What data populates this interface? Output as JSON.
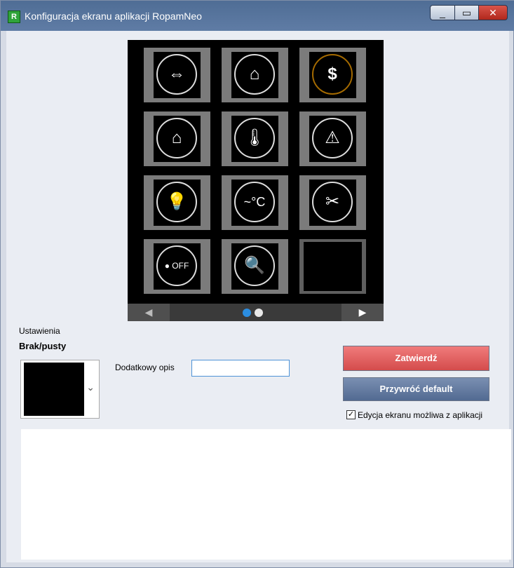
{
  "window": {
    "title": "Konfiguracja ekranu aplikacji RopamNeo",
    "controls": [
      "_",
      "▭",
      "✕"
    ]
  },
  "tiles": [
    {
      "icon": "gate-icon",
      "glyph": "⇔"
    },
    {
      "icon": "house-search-icon",
      "glyph": "⌂"
    },
    {
      "icon": "dollar-icon",
      "glyph": "$"
    },
    {
      "icon": "house-shield-icon",
      "glyph": "⌂"
    },
    {
      "icon": "thermometer-icon",
      "glyph": "🌡"
    },
    {
      "icon": "warning-icon",
      "glyph": "⚠"
    },
    {
      "icon": "lightbulb-icon",
      "glyph": "💡"
    },
    {
      "icon": "temperature-chart-icon",
      "glyph": "~°C"
    },
    {
      "icon": "tools-icon",
      "glyph": "✂"
    },
    {
      "icon": "switch-off-icon",
      "glyph": "● OFF"
    },
    {
      "icon": "document-search-icon",
      "glyph": "🔍"
    },
    {
      "icon": "empty-slot",
      "glyph": ""
    }
  ],
  "pager": {
    "prev": "◀",
    "next": "▶",
    "pages": 2,
    "current": 1
  },
  "settings": {
    "section_label": "Ustawienia",
    "selected_item": "Brak/pusty",
    "description_label": "Dodatkowy opis",
    "description_value": ""
  },
  "actions": {
    "confirm_label": "Zatwierdź",
    "reset_label": "Przywróć default",
    "checkbox_label": "Edycja ekranu możliwa z aplikacji",
    "checkbox_checked": true
  }
}
